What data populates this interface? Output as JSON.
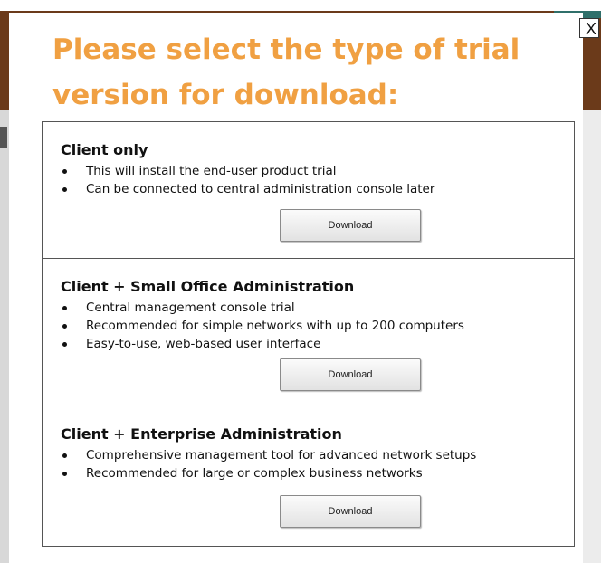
{
  "dialog": {
    "close_label": "X",
    "title": "Please select the type of trial version for download:"
  },
  "options": [
    {
      "title": "Client only",
      "bullets": [
        "This will install the end-user product trial",
        "Can be connected to central administration console later"
      ],
      "button_label": "Download"
    },
    {
      "title": "Client + Small Office Administration",
      "bullets": [
        "Central management console trial",
        "Recommended for simple networks with up to 200 computers",
        "Easy-to-use, web-based user interface"
      ],
      "button_label": "Download"
    },
    {
      "title": "Client + Enterprise Administration",
      "bullets": [
        "Comprehensive management tool for advanced network setups",
        "Recommended for large or complex business networks"
      ],
      "button_label": "Download"
    }
  ],
  "colors": {
    "title": "#f0a042",
    "background_header": "#6b3a1a"
  }
}
